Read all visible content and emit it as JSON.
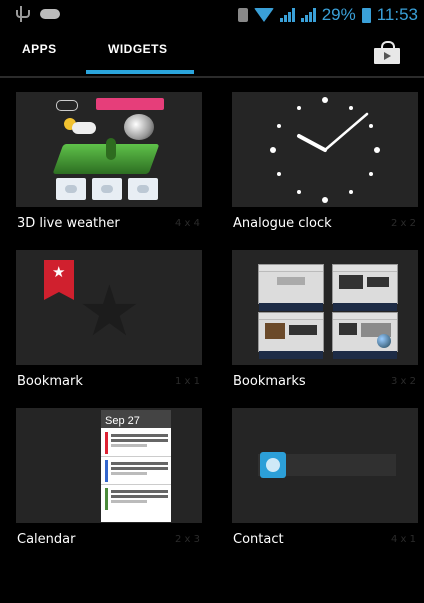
{
  "status_bar": {
    "battery_percent": "29%",
    "time": "11:53",
    "accent": "#3aa0d8"
  },
  "tabs": {
    "apps_label": "APPS",
    "widgets_label": "WIDGETS",
    "active": "WIDGETS",
    "accent": "#2aa4dc"
  },
  "widgets": [
    {
      "label": "3D live weather",
      "size": "4 x 4"
    },
    {
      "label": "Analogue clock",
      "size": "2 x 2"
    },
    {
      "label": "Bookmark",
      "size": "1 x 1"
    },
    {
      "label": "Bookmarks",
      "size": "3 x 2"
    },
    {
      "label": "Calendar",
      "size": "2 x 3"
    },
    {
      "label": "Contact",
      "size": "4 x 1"
    }
  ],
  "calendar_preview": {
    "date": "Sep 27"
  },
  "icons": [
    "usb-icon",
    "gamepad-icon",
    "sim-icon",
    "wifi-icon",
    "signal-icon",
    "battery-icon",
    "play-store-icon"
  ]
}
